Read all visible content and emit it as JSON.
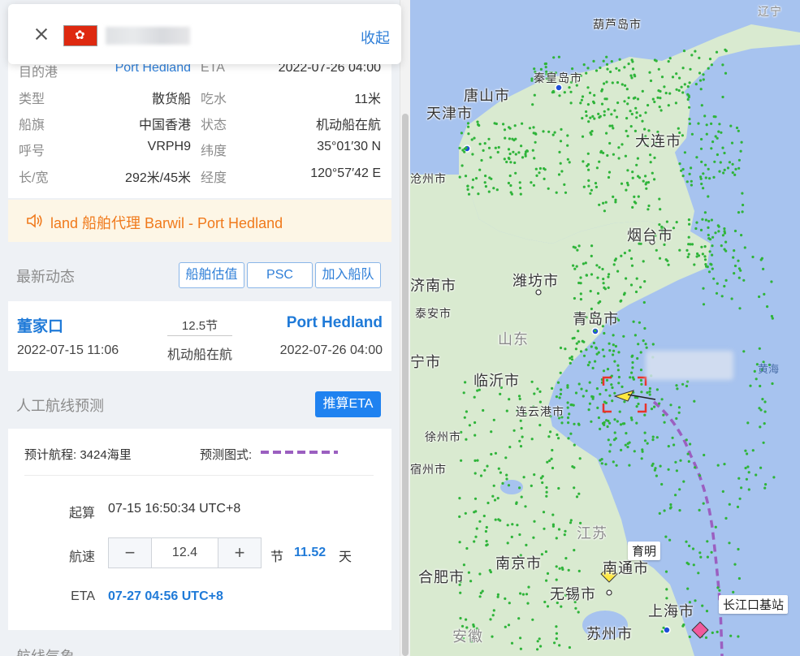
{
  "header": {
    "close_icon": "close-icon",
    "flag_icon": "hong-kong-flag-icon",
    "collapse_label": "收起"
  },
  "info": {
    "rows": [
      {
        "k1": "目的港",
        "v1": "Port Hedland",
        "k2": "ETA",
        "v2": "2022-07-26 04:00"
      },
      {
        "k1": "类型",
        "v1": "散货船",
        "k2": "吃水",
        "v2": "11米"
      },
      {
        "k1": "船旗",
        "v1": "中国香港",
        "k2": "状态",
        "v2": "机动船在航"
      },
      {
        "k1": "呼号",
        "v1": "VRPH9",
        "k2": "纬度",
        "v2": "35°01′30 N"
      },
      {
        "k1": "长/宽",
        "v1": "292米/45米",
        "k2": "经度",
        "v2": "120°57′42 E"
      }
    ]
  },
  "notice": {
    "icon": "speaker-icon",
    "text": "land 船舶代理 Barwil - Port Hedland"
  },
  "latest": {
    "title": "最新动态",
    "buttons": [
      "船舶估值",
      "PSC",
      "加入船队"
    ]
  },
  "voyage": {
    "from": "董家口",
    "from_time": "2022-07-15 11:06",
    "speed": "12.5节",
    "status": "机动船在航",
    "to": "Port Hedland",
    "to_time": "2022-07-26 04:00"
  },
  "route": {
    "title": "人工航线预测",
    "eta_button": "推算ETA",
    "distance": "预计航程: 3424海里",
    "style_label": "预测图式:",
    "start_label": "起算",
    "start_value": "07-15 16:50:34 UTC+8",
    "speed_label": "航速",
    "speed_value": "12.4",
    "speed_unit": "节",
    "days_value": "11.52",
    "days_unit": "天",
    "eta_label": "ETA",
    "eta_value": "07-27 04:56 UTC+8"
  },
  "next_section_title": "航线气象",
  "map": {
    "colors": {
      "sea": "#a7c3ef",
      "land": "#d9ead0",
      "route": "#9b5fc0",
      "ais_dots": "#2fb43a",
      "target": "#e8332a"
    },
    "cities": [
      {
        "name": "葫芦岛市",
        "cls": "small"
      },
      {
        "name": "辽宁",
        "cls": "small faint"
      },
      {
        "name": "秦皇岛市",
        "cls": "small"
      },
      {
        "name": "唐山市",
        "cls": ""
      },
      {
        "name": "天津市",
        "cls": ""
      },
      {
        "name": "大连市",
        "cls": ""
      },
      {
        "name": "沧州市",
        "cls": "small"
      },
      {
        "name": "烟台市",
        "cls": ""
      },
      {
        "name": "济南市",
        "cls": ""
      },
      {
        "name": "潍坊市",
        "cls": ""
      },
      {
        "name": "泰安市",
        "cls": "small"
      },
      {
        "name": "青岛市",
        "cls": ""
      },
      {
        "name": "山东",
        "cls": "faint"
      },
      {
        "name": "宁市",
        "cls": ""
      },
      {
        "name": "临沂市",
        "cls": ""
      },
      {
        "name": "连云港市",
        "cls": "small"
      },
      {
        "name": "徐州市",
        "cls": "small"
      },
      {
        "name": "宿州市",
        "cls": "small"
      },
      {
        "name": "江苏",
        "cls": "faint"
      },
      {
        "name": "合肥市",
        "cls": ""
      },
      {
        "name": "南京市",
        "cls": ""
      },
      {
        "name": "南通市",
        "cls": ""
      },
      {
        "name": "无锡市",
        "cls": ""
      },
      {
        "name": "上海市",
        "cls": ""
      },
      {
        "name": "苏州市",
        "cls": ""
      },
      {
        "name": "安徽",
        "cls": "faint"
      }
    ],
    "sea_label": "黄海",
    "tags": [
      "育明",
      "长江口基站"
    ]
  }
}
